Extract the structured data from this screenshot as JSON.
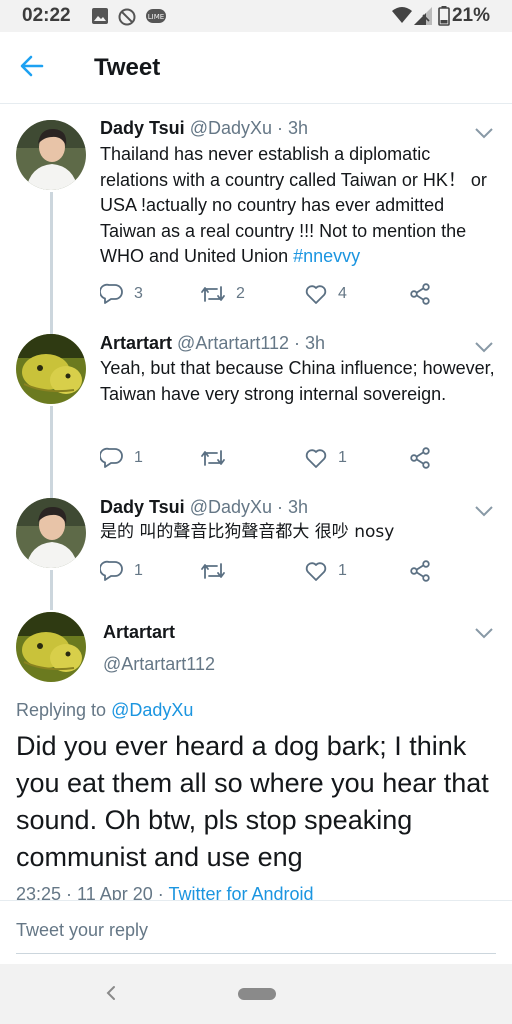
{
  "status_bar": {
    "time": "02:22",
    "battery": "21%",
    "left_icons": [
      "image-icon",
      "no-disturb-icon",
      "lime-app-icon"
    ],
    "right_icons": [
      "wifi-icon",
      "signal-icon",
      "battery-icon"
    ]
  },
  "header": {
    "title": "Tweet",
    "back_icon": "arrow-left-icon"
  },
  "thread": [
    {
      "name": "Dady Tsui",
      "handle": "@DadyXu",
      "time": "· 3h",
      "text_before_tag": "Thailand has never establish a diplomatic relations with a country called Taiwan or HK！ or USA !actually no country has ever admitted Taiwan as a real country !!! Not to mention the WHO and United Union ",
      "hashtag": "#nnevvy",
      "replies": "3",
      "retweets": "2",
      "likes": "4"
    },
    {
      "name": "Artartart",
      "handle": "@Artartart112",
      "time": "· 3h",
      "text": "Yeah, but that because China influence; however, Taiwan have very strong internal sovereign.",
      "replies": "1",
      "retweets": "",
      "likes": "1"
    },
    {
      "name": "Dady Tsui",
      "handle": "@DadyXu",
      "time": "· 3h",
      "text": "是的 叫的聲音比狗聲音都大 很吵 nosy",
      "replies": "1",
      "retweets": "",
      "likes": "1"
    }
  ],
  "main_tweet": {
    "name": "Artartart",
    "handle": "@Artartart112",
    "replying_prefix": "Replying to ",
    "replying_to": "@DadyXu",
    "text": "Did you ever heard a dog bark; I think you eat them all so where you hear that sound. Oh btw, pls stop speaking communist and use eng",
    "timestamp": "23:25 · 11 Apr 20 · ",
    "source": "Twitter for Android"
  },
  "reply_bar": {
    "placeholder": "Tweet your reply"
  },
  "colors": {
    "accent": "#1da1f2",
    "link": "#1b95e0",
    "secondary_text": "#657786",
    "divider": "#e6ecf0"
  }
}
